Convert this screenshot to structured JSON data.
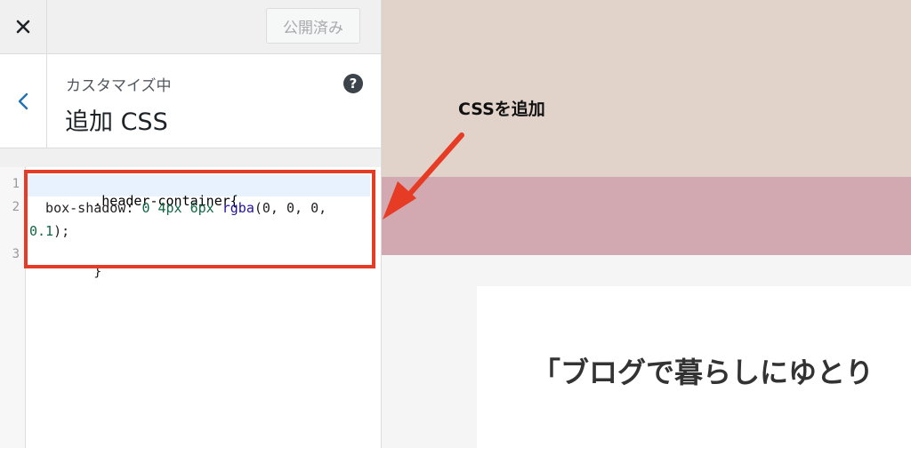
{
  "topbar": {
    "close_icon": "close-icon",
    "publish_label": "公開済み"
  },
  "section": {
    "back_icon": "chevron-left-icon",
    "customizing_label": "カスタマイズ中",
    "title": "追加 CSS",
    "help_icon": "help-icon",
    "help_glyph": "?"
  },
  "editor": {
    "line_numbers": [
      "1",
      "2",
      "3"
    ],
    "lines": [
      {
        "selector": ".header-container{"
      },
      {
        "prop": "  box-shadow: ",
        "v1": "0",
        "v2": "4px",
        "v3": "6px",
        "fn": "rgba",
        "args": "(0, 0, 0,",
        "cont": "0.1",
        "end": ");"
      },
      {
        "close": "}"
      }
    ]
  },
  "annotation": {
    "label": "CSSを追加",
    "color": "#e63b24"
  },
  "preview": {
    "top_color": "#e1d3ca",
    "header_color": "#d2a8b1",
    "card_title": "「ブログで暮らしにゆとり"
  }
}
